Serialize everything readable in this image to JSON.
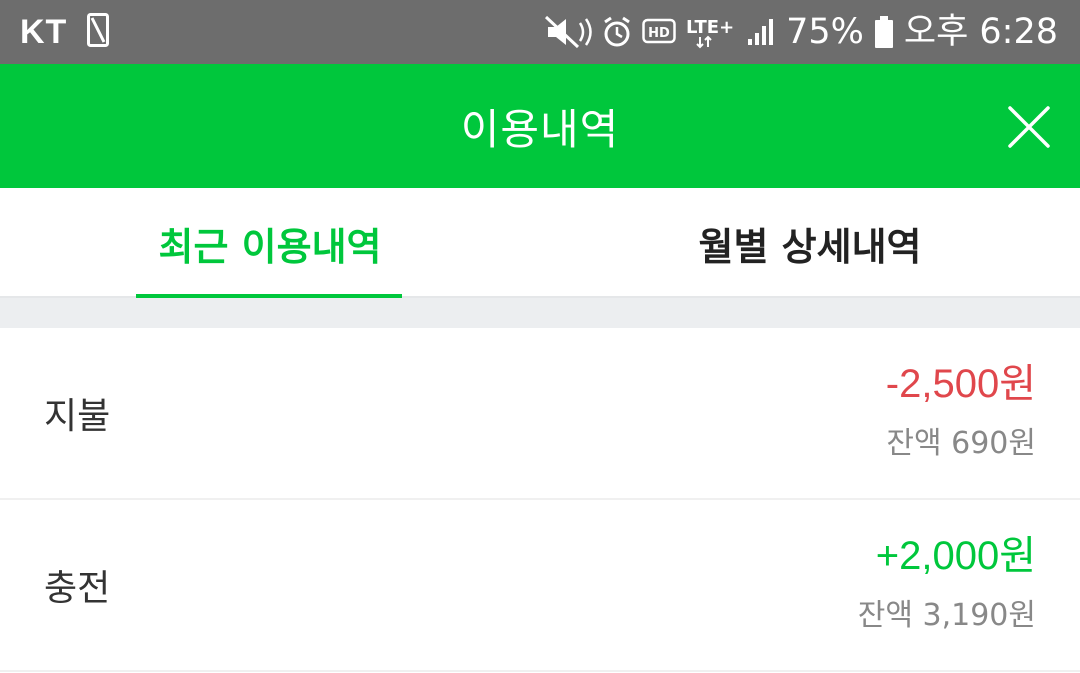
{
  "status_bar": {
    "carrier": "KT",
    "battery": "75%",
    "time": "오후 6:28",
    "icons": [
      "phone-icon",
      "mute-icon",
      "alarm-icon",
      "hd-voice-icon",
      "lte-icon",
      "signal-icon",
      "battery-icon"
    ],
    "lte_label": "LTE+"
  },
  "header": {
    "title": "이용내역",
    "close_icon": "close-icon"
  },
  "tabs": [
    {
      "label": "최근 이용내역",
      "active": true
    },
    {
      "label": "월별 상세내역",
      "active": false
    }
  ],
  "history": [
    {
      "type": "지불",
      "amount": "-2,500원",
      "balance": "잔액 690원"
    },
    {
      "type": "충전",
      "amount": "+2,000원",
      "balance": "잔액 3,190원"
    }
  ],
  "colors": {
    "brand_green": "#00c73c",
    "negative_red": "#e0474c",
    "status_bar": "#6d6d6d"
  }
}
